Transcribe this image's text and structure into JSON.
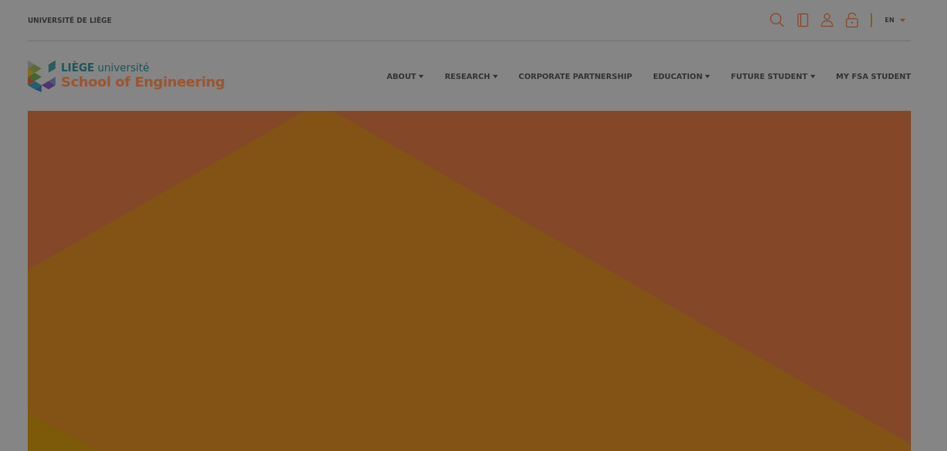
{
  "top_bar": {
    "institution": "UNIVERSITÉ DE LIÈGE",
    "language": "EN"
  },
  "logo": {
    "brand_bold": "LIÈGE",
    "brand_light": "université",
    "subtitle": "School of Engineering"
  },
  "nav": [
    {
      "label": "ABOUT",
      "has_dropdown": true
    },
    {
      "label": "RESEARCH",
      "has_dropdown": true
    },
    {
      "label": "CORPORATE PARTNERSHIP",
      "has_dropdown": false
    },
    {
      "label": "EDUCATION",
      "has_dropdown": true
    },
    {
      "label": "FUTURE STUDENT",
      "has_dropdown": true
    },
    {
      "label": "MY FSA STUDENT",
      "has_dropdown": false
    }
  ]
}
